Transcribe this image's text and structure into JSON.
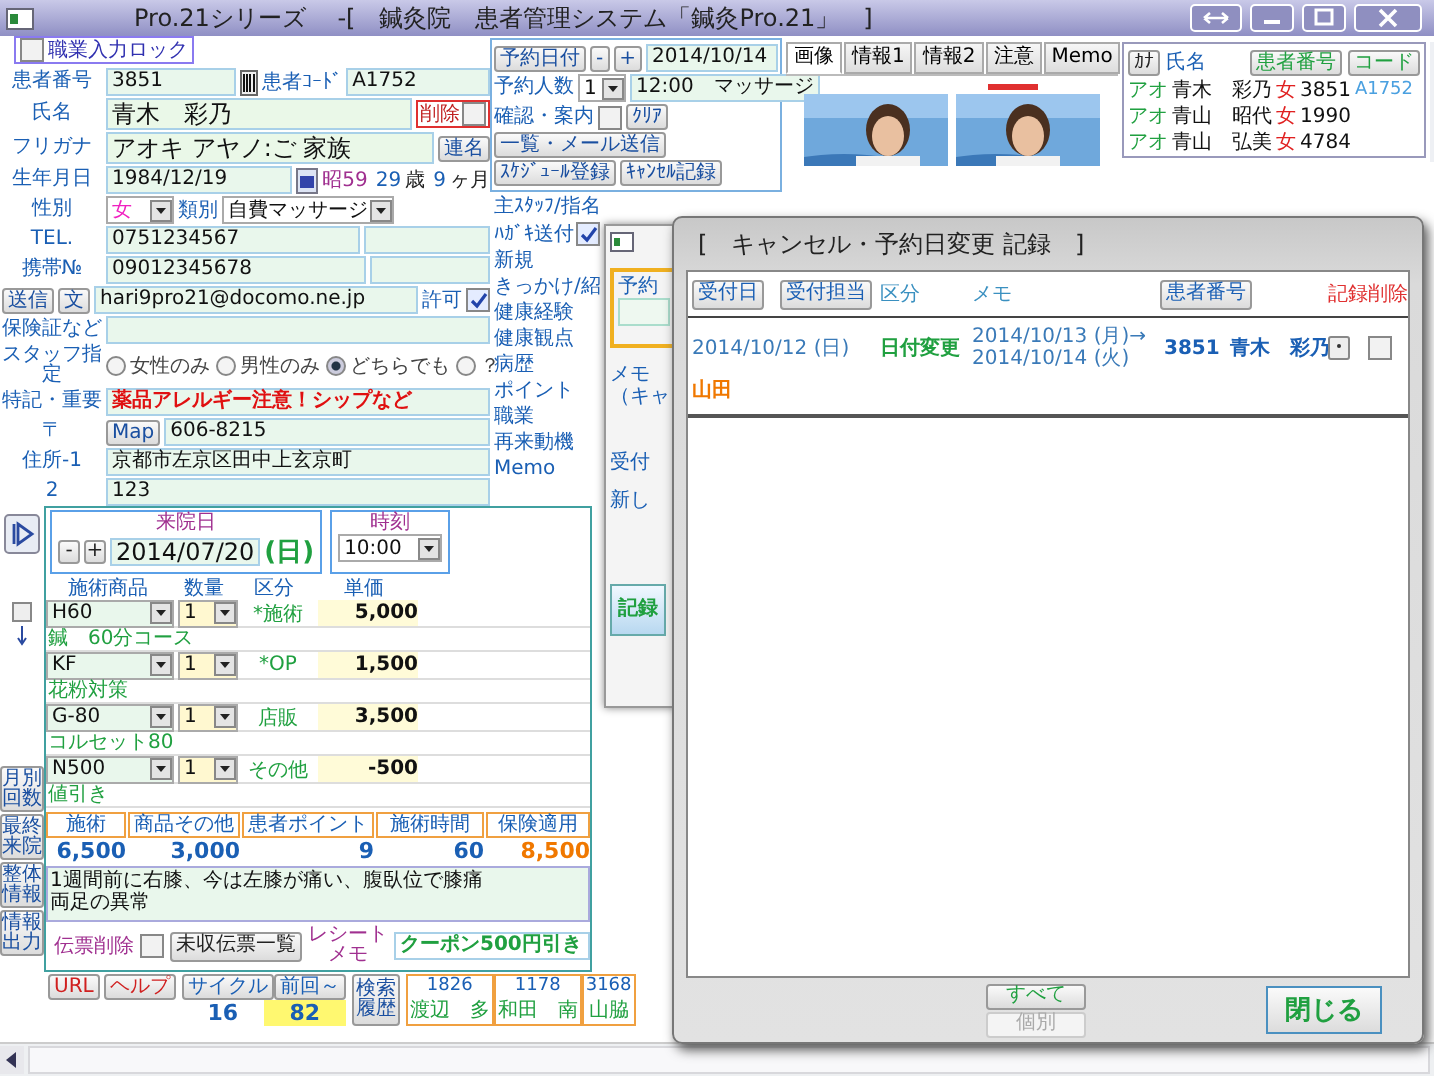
{
  "window": {
    "title": "Pro.21シリーズ　 -[　鍼灸院　患者管理システム「鍼灸Pro.21」　]"
  },
  "lock": {
    "label": "職業入力ロック",
    "checked": false
  },
  "patient_rows": [
    {
      "cells": [
        {
          "kind": "label",
          "text": "患者番号"
        },
        {
          "kind": "field",
          "value": "3851"
        },
        {
          "kind": "barcode"
        },
        {
          "kind": "label",
          "text": "患者ｺｰﾄﾞ"
        },
        {
          "kind": "field",
          "value": "A1752"
        }
      ]
    },
    {
      "cells": [
        {
          "kind": "label",
          "text": "氏名"
        },
        {
          "kind": "name_field",
          "value": "青木　彩乃"
        },
        {
          "kind": "alert_check",
          "text": "削除",
          "checked": false
        }
      ]
    },
    {
      "cells": [
        {
          "kind": "label",
          "text": "フリガナ"
        },
        {
          "kind": "name_field",
          "value": "アオキ アヤノ:ご 家族"
        },
        {
          "kind": "button",
          "text": "連名"
        }
      ]
    },
    {
      "cells": [
        {
          "kind": "label",
          "text": "生年月日"
        },
        {
          "kind": "field",
          "value": "1984/12/19"
        },
        {
          "kind": "calendar"
        },
        {
          "kind": "era",
          "text": "昭59"
        },
        {
          "kind": "num",
          "text": "29"
        },
        {
          "kind": "unit",
          "text": "歳"
        },
        {
          "kind": "num",
          "text": "9"
        },
        {
          "kind": "unit",
          "text": "ヶ月"
        }
      ]
    },
    {
      "cells": [
        {
          "kind": "label",
          "text": "性別"
        },
        {
          "kind": "gender_select",
          "value": "女"
        },
        {
          "kind": "label",
          "text": "類別"
        },
        {
          "kind": "select",
          "value": "自費マッサージ"
        }
      ]
    },
    {
      "cells": [
        {
          "kind": "label",
          "text": "TEL."
        },
        {
          "kind": "field",
          "value": "0751234567"
        },
        {
          "kind": "field"
        }
      ]
    },
    {
      "cells": [
        {
          "kind": "label",
          "text": "携帯№"
        },
        {
          "kind": "field",
          "value": "09012345678"
        },
        {
          "kind": "field"
        }
      ]
    },
    {
      "cells": [
        {
          "kind": "button",
          "text": "送信"
        },
        {
          "kind": "button",
          "text": "文"
        },
        {
          "kind": "field",
          "value": "hari9pro21@docomo.ne.jp"
        },
        {
          "kind": "check",
          "text": "許可",
          "checked": true
        }
      ]
    },
    {
      "cells": [
        {
          "kind": "label",
          "text": "保険証など"
        },
        {
          "kind": "field"
        }
      ]
    },
    {
      "cells": [
        {
          "kind": "label",
          "text": "スタッフ指定"
        },
        {
          "kind": "radio",
          "text": "女性のみ",
          "selected": false
        },
        {
          "kind": "radio",
          "text": "男性のみ",
          "selected": false
        },
        {
          "kind": "radio",
          "text": "どちらでも",
          "selected": true
        },
        {
          "kind": "radio",
          "text": "？",
          "selected": false
        }
      ]
    },
    {
      "cells": [
        {
          "kind": "label",
          "text": "特記・重要"
        },
        {
          "kind": "alert_field",
          "value": "薬品アレルギー注意！シップなど"
        }
      ]
    },
    {
      "cells": [
        {
          "kind": "label",
          "text": "〒"
        },
        {
          "kind": "button",
          "text": "Map"
        },
        {
          "kind": "field",
          "value": "606-8215"
        }
      ]
    },
    {
      "cells": [
        {
          "kind": "label",
          "text": "住所-1"
        },
        {
          "kind": "field",
          "value": "京都市左京区田中上玄京町"
        }
      ]
    },
    {
      "cells": [
        {
          "kind": "label",
          "text": "2"
        },
        {
          "kind": "field",
          "value": "123"
        }
      ]
    }
  ],
  "reservation_rows": [
    {
      "cells": [
        {
          "kind": "button",
          "text": "予約日付"
        },
        {
          "kind": "button",
          "text": "-"
        },
        {
          "kind": "button",
          "text": "+"
        },
        {
          "kind": "field",
          "value": "2014/10/14"
        }
      ]
    },
    {
      "cells": [
        {
          "kind": "label",
          "text": "予約人数"
        },
        {
          "kind": "select",
          "value": "1"
        },
        {
          "kind": "field",
          "value": "12:00　マッサージ"
        }
      ]
    },
    {
      "cells": [
        {
          "kind": "label",
          "text": "確認・案内"
        },
        {
          "kind": "check",
          "checked": false
        },
        {
          "kind": "button",
          "text": "ｸﾘｱ"
        }
      ]
    },
    {
      "cells": [
        {
          "kind": "button",
          "text": "一覧・メール送信"
        }
      ]
    },
    {
      "cells": [
        {
          "kind": "button",
          "text": "ｽｹｼﾞｭｰﾙ登録"
        },
        {
          "kind": "button",
          "text": "ｷｬﾝｾﾙ記録"
        }
      ]
    }
  ],
  "side_labels": [
    {
      "text": "主ｽﾀｯﾌ/指名"
    },
    {
      "text": "ﾊｶﾞｷ送付",
      "checked": true
    },
    {
      "text": "新規"
    },
    {
      "text": "きっかけ/紹"
    },
    {
      "text": "健康経験"
    },
    {
      "text": "健康観点"
    },
    {
      "text": "病歴"
    },
    {
      "text": "ポイント"
    },
    {
      "text": "職業"
    },
    {
      "text": "再来動機"
    },
    {
      "text": "Memo"
    }
  ],
  "back_window": {
    "texts": [
      "予約",
      "メモ",
      "（キャ",
      "受付",
      "新し"
    ],
    "button": "記録"
  },
  "side_tabs": [
    "月別回数",
    "最終来院",
    "整体情報",
    "情報出力"
  ],
  "visit": {
    "date_label": "来院日",
    "stepper": [
      "-",
      "+"
    ],
    "date": "2014/07/20",
    "weekday": "(日)",
    "time_label": "時刻",
    "time": "10:00",
    "headers": [
      "施術商品",
      "数量",
      "区分",
      "単価"
    ],
    "items": [
      {
        "code": "H60",
        "qty": "1",
        "category": "*施術",
        "price": "5,000",
        "name": "鍼　60分コース"
      },
      {
        "code": "KF",
        "qty": "1",
        "category": "*OP",
        "price": "1,500",
        "name": "花粉対策"
      },
      {
        "code": "G-80",
        "qty": "1",
        "category": "店販",
        "price": "3,500",
        "name": "コルセット80"
      },
      {
        "code": "N500",
        "qty": "1",
        "category": "その他",
        "price": "-500",
        "name": "値引き"
      }
    ],
    "totals": [
      {
        "label": "施術",
        "value": "6,500"
      },
      {
        "label": "商品その他",
        "value": "3,000"
      },
      {
        "label": "患者ポイント",
        "value": "9"
      },
      {
        "label": "施術時間",
        "value": "60"
      },
      {
        "label": "保険適用",
        "value": "8,500"
      }
    ],
    "memo": [
      "1週間前に右膝、今は左膝が痛い、腹臥位で膝痛",
      "両足の異常"
    ],
    "slip_delete": {
      "label": "伝票削除",
      "checked": false
    },
    "unpaid_button": "未収伝票一覧",
    "receipt_label": "レシートメモ",
    "receipt_memo": "クーポン500円引き"
  },
  "footer": {
    "links": [
      "URL",
      "ヘルプ"
    ],
    "cycle_label": "サイクル",
    "last_label": "前回～",
    "cycle": "16",
    "last": "82",
    "history_button": "検索履歴",
    "recent": [
      {
        "number": "1826",
        "name": "渡辺　多"
      },
      {
        "number": "1178",
        "name": "和田　南"
      },
      {
        "number": "3168",
        "name": "山脇"
      }
    ]
  },
  "tabs": [
    {
      "label": "画像",
      "selected": true
    },
    {
      "label": "情報1",
      "selected": false
    },
    {
      "label": "情報2",
      "selected": false
    },
    {
      "label": "注意",
      "selected": false
    },
    {
      "label": "Memo",
      "selected": false
    }
  ],
  "name_list": {
    "kana_button": "ｶﾅ",
    "name_header": "氏名",
    "number_button": "患者番号",
    "code_button": "コード",
    "rows": [
      {
        "kana": "アオ",
        "name": "青木　彩乃",
        "gender": "女",
        "number": "3851",
        "code": "A1752"
      },
      {
        "kana": "アオ",
        "name": "青山　昭代",
        "gender": "女",
        "number": "1990"
      },
      {
        "kana": "アオ",
        "name": "青山　弘美",
        "gender": "女",
        "number": "4784"
      }
    ]
  },
  "dialog": {
    "title": "[　キャンセル・予約日変更 記録　]",
    "columns": [
      {
        "kind": "button",
        "label": "受付日"
      },
      {
        "kind": "button",
        "label": "受付担当"
      },
      {
        "kind": "text",
        "label": "区分"
      },
      {
        "kind": "text",
        "label": "メモ"
      },
      {
        "kind": "button",
        "label": "患者番号"
      },
      {
        "kind": "alert",
        "label": "記録削除"
      }
    ],
    "rows": [
      {
        "date": "2014/10/12 (日)",
        "staff": "山田",
        "change": "日付変更",
        "memo": [
          "2014/10/13 (月)→",
          "2014/10/14 (火)"
        ],
        "number": "3851",
        "name": "青木　彩乃",
        "checked": false
      }
    ],
    "buttons": [
      {
        "label": "すべて",
        "disabled": false
      },
      {
        "label": "個別",
        "disabled": true
      }
    ],
    "close": "閉じる"
  }
}
